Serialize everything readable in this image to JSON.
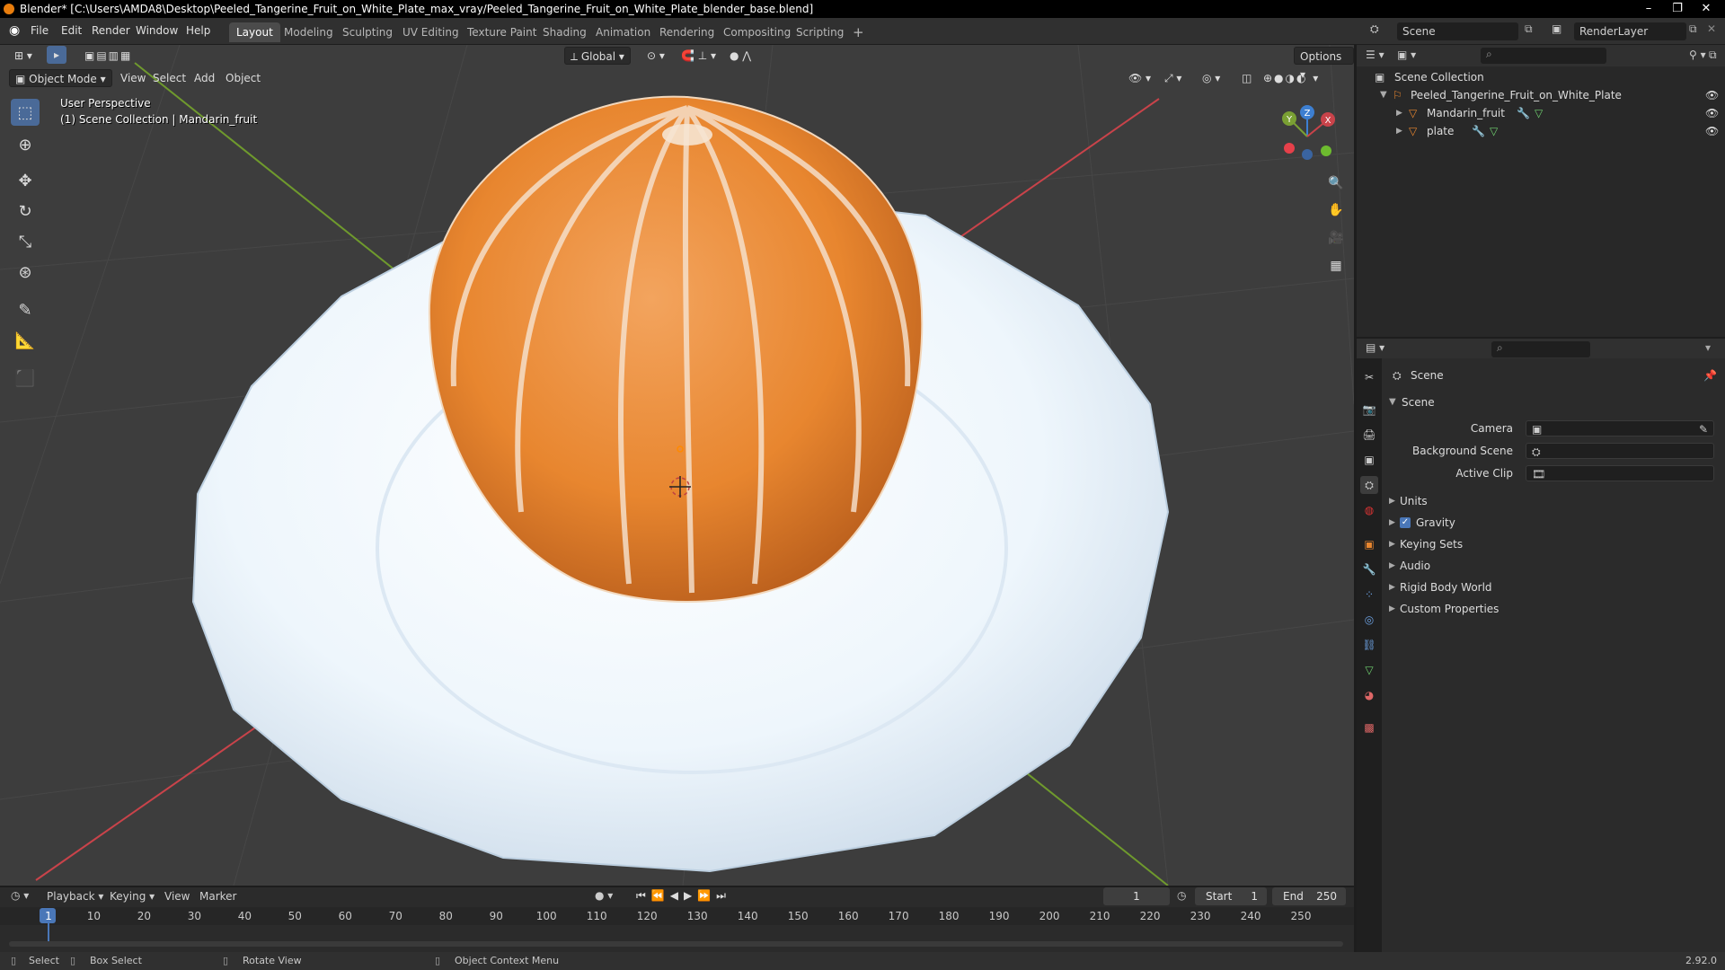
{
  "window": {
    "title": "Blender* [C:\\Users\\AMDA8\\Desktop\\Peeled_Tangerine_Fruit_on_White_Plate_max_vray/Peeled_Tangerine_Fruit_on_White_Plate_blender_base.blend]"
  },
  "menubar": {
    "menus": [
      "File",
      "Edit",
      "Render",
      "Window",
      "Help"
    ],
    "workspaces": [
      "Layout",
      "Modeling",
      "Sculpting",
      "UV Editing",
      "Texture Paint",
      "Shading",
      "Animation",
      "Rendering",
      "Compositing",
      "Scripting"
    ],
    "active_workspace": "Layout",
    "add_tab": "+",
    "scene": "Scene",
    "view_layer": "RenderLayer"
  },
  "viewport": {
    "mode": "Object Mode",
    "menus": [
      "View",
      "Select",
      "Add",
      "Object"
    ],
    "transform_orientation": "Global",
    "options": "Options",
    "overlay_title": "User Perspective",
    "overlay_subtitle": "(1) Scene Collection | Mandarin_fruit",
    "gizmo": {
      "z": "Z",
      "y": "Y",
      "x": "X"
    }
  },
  "outliner": {
    "root": "Scene Collection",
    "collection": "Peeled_Tangerine_Fruit_on_White_Plate",
    "objects": [
      "Mandarin_fruit",
      "plate"
    ]
  },
  "properties": {
    "context": "Scene",
    "panel": "Scene",
    "fields": [
      {
        "label": "Camera"
      },
      {
        "label": "Background Scene"
      },
      {
        "label": "Active Clip"
      }
    ],
    "subpanels": [
      "Units",
      "Gravity",
      "Keying Sets",
      "Audio",
      "Rigid Body World",
      "Custom Properties"
    ],
    "gravity_checked": true
  },
  "timeline": {
    "menus": [
      "Playback",
      "Keying",
      "View",
      "Marker"
    ],
    "current_frame": "1",
    "start_label": "Start",
    "start": "1",
    "end_label": "End",
    "end": "250",
    "ticks": [
      "1",
      "10",
      "20",
      "30",
      "40",
      "50",
      "60",
      "70",
      "80",
      "90",
      "100",
      "110",
      "120",
      "130",
      "140",
      "150",
      "160",
      "170",
      "180",
      "190",
      "200",
      "210",
      "220",
      "230",
      "240",
      "250"
    ]
  },
  "statusbar": {
    "select": "Select",
    "box_select": "Box Select",
    "rotate_view": "Rotate View",
    "context_menu": "Object Context Menu",
    "version": "2.92.0"
  },
  "colors": {
    "accent": "#4a6a98",
    "orange": "#e8862f",
    "axis_x": "#c9434a",
    "axis_y": "#7aa033",
    "axis_z": "#3d7fd1"
  }
}
